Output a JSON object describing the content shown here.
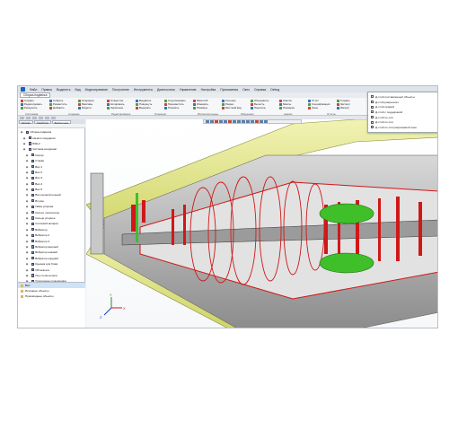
{
  "menubar": {
    "items": [
      "Файл",
      "Правка",
      "Выделить",
      "Вид",
      "Моделирование",
      "Построение",
      "Инструменты",
      "Диагностика",
      "Управление",
      "Настройка",
      "Приложения",
      "Окно",
      "Справка",
      "Debug"
    ]
  },
  "tabs": [
    {
      "label": "Сборка-подвеска"
    }
  ],
  "ribbon": {
    "columns": [
      [
        "Создать",
        "Редактировать",
        "Разрушить"
      ],
      [
        "Собрать",
        "Разместить",
        "Добавить"
      ],
      [
        "Операции",
        "Массивы",
        "Модели"
      ],
      [
        "Отверстие",
        "Копировать",
        "Зеркально"
      ],
      [
        "Выдавить",
        "Повернуть",
        "Вырезать"
      ],
      [
        "Сгруппировать",
        "Переместить",
        "Показать"
      ],
      [
        "Масштаб",
        "Измерить",
        "Размеры"
      ],
      [
        "Сечение",
        "Разрез",
        "Местный вид"
      ],
      [
        "Объединить",
        "Вычесть",
        "Пересечь"
      ],
      [
        "Анализ",
        "Массы",
        "Проверка"
      ],
      [
        "Отчёт",
        "Спецификация",
        "Зоны"
      ],
      [
        "Создать",
        "Экспорт",
        "Импорт"
      ]
    ],
    "groups": [
      "Системная",
      "Создание",
      "Редактирование",
      "Операции",
      "Вспомогательные",
      "Измерения",
      "Анализ",
      "Отчёты"
    ]
  },
  "search": {
    "value": "Д-стой",
    "results": [
      "Д-стой поставленный объекты",
      "Д-стой разрезного",
      "Д-стой прямой",
      "Д-стой с поддержкой",
      "Д-стой по оси",
      "Д-стой по оси",
      "Д-стой по оси разрезанной зоне"
    ]
  },
  "panel": {
    "tabs": [
      "Дерево",
      "Свойства",
      "Библиотеки"
    ],
    "tree": [
      {
        "label": "Сборка-подвеска",
        "kind": "asm"
      },
      {
        "label": "Начало координат",
        "kind": "folder"
      },
      {
        "label": "БЧЕ-2",
        "kind": "part"
      },
      {
        "label": "Система координат",
        "kind": "folder"
      },
      {
        "label": "Корпус",
        "kind": "part"
      },
      {
        "label": "Стакан",
        "kind": "part"
      },
      {
        "label": "Вал 1",
        "kind": "part"
      },
      {
        "label": "Вал 2",
        "kind": "part"
      },
      {
        "label": "Вал 3",
        "kind": "part"
      },
      {
        "label": "Вал 4",
        "kind": "part"
      },
      {
        "label": "Вал 5",
        "kind": "part"
      },
      {
        "label": "Вал нагнетательный",
        "kind": "part"
      },
      {
        "label": "Втулка",
        "kind": "part"
      },
      {
        "label": "Гайка упорная",
        "kind": "part"
      },
      {
        "label": "Колесо лопаточное",
        "kind": "part"
      },
      {
        "label": "Кольцо упорное",
        "kind": "part"
      },
      {
        "label": "Сопловой аппарат",
        "kind": "part"
      },
      {
        "label": "Вибратор",
        "kind": "part"
      },
      {
        "label": "Вибратор 2",
        "kind": "part"
      },
      {
        "label": "Вибратор 3",
        "kind": "part"
      },
      {
        "label": "Вибратор верхний",
        "kind": "part"
      },
      {
        "label": "Вибратор нижний",
        "kind": "part"
      },
      {
        "label": "Вибратор средний",
        "kind": "part"
      },
      {
        "label": "Крышка для Гомм",
        "kind": "part"
      },
      {
        "label": "Обтекатель",
        "kind": "part"
      },
      {
        "label": "Ось стопа колеса",
        "kind": "part"
      },
      {
        "label": "Уплотнение подшипника",
        "kind": "part"
      }
    ],
    "properties": [
      {
        "label": "Вал",
        "selected": true
      },
      {
        "label": "Исходные объекты",
        "selected": false
      },
      {
        "label": "Производные объекты",
        "selected": false
      }
    ]
  },
  "viewport": {
    "axes": {
      "x": "X",
      "y": "Y",
      "z": "Z"
    }
  },
  "colors": {
    "accent": "#1565c0",
    "section_red": "#d01818",
    "casing_yellow": "#e4e88a",
    "green_part": "#3fbf2a",
    "gray_part": "#a8a8a8"
  }
}
